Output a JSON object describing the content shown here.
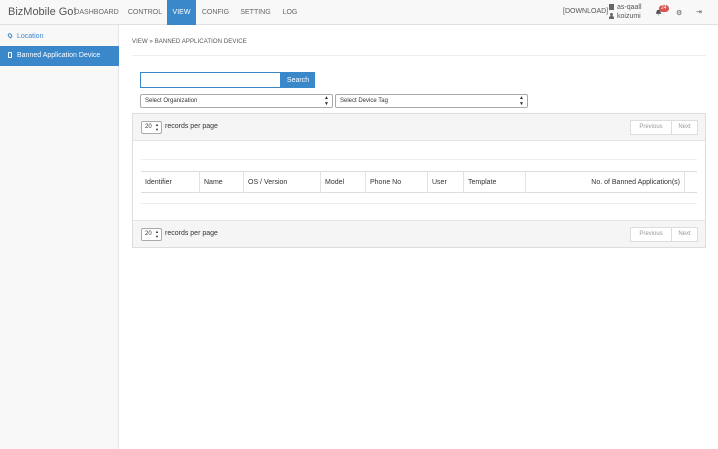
{
  "app": {
    "brand": "BizMobile Go!"
  },
  "nav": {
    "items": [
      {
        "label": "DASHBOARD"
      },
      {
        "label": "CONTROL"
      },
      {
        "label": "VIEW"
      },
      {
        "label": "CONFIG"
      },
      {
        "label": "SETTING"
      },
      {
        "label": "LOG"
      }
    ],
    "active": "VIEW",
    "download": "[DOWNLOAD]",
    "account": "as-qaall",
    "username": "koizumi",
    "notification_count": "24"
  },
  "icons": {
    "building": "building-icon",
    "user": "user-icon",
    "bell": "bell-icon",
    "gear": "gear-icon",
    "signout": "sign-out-icon",
    "location": "map-marker-icon",
    "device": "mobile-icon"
  },
  "sidebar": {
    "items": [
      {
        "label": "Location"
      },
      {
        "label": "Banned Application Device"
      }
    ]
  },
  "main": {
    "breadcrumb": "VIEW » BANNED APPLICATION DEVICE",
    "search": {
      "value": "",
      "button": "Search"
    },
    "filters": {
      "organization": "Select Organization",
      "device_tag": "Select Device Tag"
    },
    "table": {
      "per_page_value": "20",
      "per_page_label": "records per page",
      "prev": "Previous",
      "next": "Next",
      "columns": [
        "Identifier",
        "Name",
        "OS / Version",
        "Model",
        "Phone No",
        "User",
        "Template",
        "No. of Banned Application(s)"
      ]
    }
  },
  "colors": {
    "accent": "#3a87c9",
    "badge": "#d9534f",
    "topbar_bg": "#f8f8f8",
    "panel_bg": "#f5f5f5"
  }
}
